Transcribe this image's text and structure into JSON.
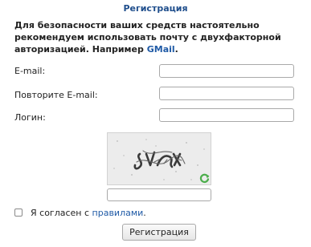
{
  "form": {
    "title": "Регистрация",
    "warning_text": "Для безопасности ваших средств настоятельно рекомендуем использовать почту с двухфакторной авторизацией. Например ",
    "warning_link": "GMail",
    "warning_end": "."
  },
  "fields": {
    "email_label": "E-mail:",
    "email_value": "",
    "email_repeat_label": "Повторите E-mail:",
    "email_repeat_value": "",
    "login_label": "Логин:",
    "login_value": ""
  },
  "captcha": {
    "image_icon": "captcha-image",
    "refresh_icon": "refresh-icon",
    "input_value": ""
  },
  "agreement": {
    "checked": false,
    "text": "Я согласен с ",
    "link": "правилами",
    "end": "."
  },
  "submit": {
    "label": "Регистрация"
  },
  "colors": {
    "title": "#1f4e8c",
    "link": "#1f5aa6",
    "refresh_icon": "#4cae4c"
  }
}
